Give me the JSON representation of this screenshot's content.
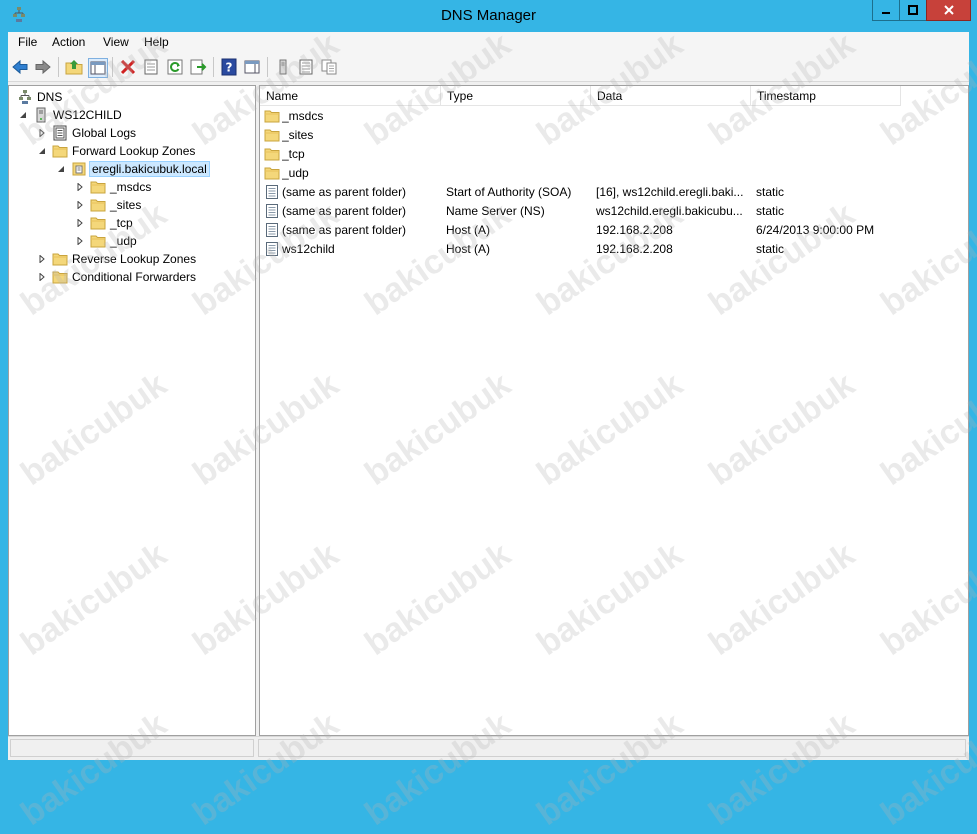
{
  "window": {
    "title": "DNS Manager"
  },
  "menu": [
    "File",
    "Action",
    "View",
    "Help"
  ],
  "toolbar": {
    "icons": [
      "back-icon",
      "forward-icon",
      "up-folder-icon",
      "show-hide-tree-icon",
      "delete-icon",
      "properties-icon",
      "refresh-icon",
      "export-list-icon",
      "help-icon",
      "show-hide-action-pane-icon",
      "new-host-icon",
      "new-record-icon",
      "copy-icon"
    ]
  },
  "tree": {
    "root": "DNS",
    "server": "WS12CHILD",
    "global_logs": "Global Logs",
    "forward_zones": "Forward Lookup Zones",
    "selected_zone": "eregli.bakicubuk.local",
    "sub_msdcs": "_msdcs",
    "sub_sites": "_sites",
    "sub_tcp": "_tcp",
    "sub_udp": "_udp",
    "reverse_zones": "Reverse Lookup Zones",
    "conditional_forwarders": "Conditional Forwarders"
  },
  "list": {
    "columns": [
      "Name",
      "Type",
      "Data",
      "Timestamp"
    ],
    "rows": [
      {
        "name": "_msdcs",
        "type": "",
        "data": "",
        "timestamp": "",
        "icon": "folder"
      },
      {
        "name": "_sites",
        "type": "",
        "data": "",
        "timestamp": "",
        "icon": "folder"
      },
      {
        "name": "_tcp",
        "type": "",
        "data": "",
        "timestamp": "",
        "icon": "folder"
      },
      {
        "name": "_udp",
        "type": "",
        "data": "",
        "timestamp": "",
        "icon": "folder"
      },
      {
        "name": "(same as parent folder)",
        "type": "Start of Authority (SOA)",
        "data": "[16], ws12child.eregli.baki...",
        "timestamp": "static",
        "icon": "record"
      },
      {
        "name": "(same as parent folder)",
        "type": "Name Server (NS)",
        "data": "ws12child.eregli.bakicubu...",
        "timestamp": "static",
        "icon": "record"
      },
      {
        "name": "(same as parent folder)",
        "type": "Host (A)",
        "data": "192.168.2.208",
        "timestamp": "6/24/2013 9:00:00 PM",
        "icon": "record"
      },
      {
        "name": "ws12child",
        "type": "Host (A)",
        "data": "192.168.2.208",
        "timestamp": "static",
        "icon": "record"
      }
    ]
  },
  "watermark": "bakicubuk",
  "colors": {
    "titlebar": "#35b5e5",
    "close": "#c7413a",
    "folder": "#f4d77a",
    "selection": "#cce8ff"
  }
}
